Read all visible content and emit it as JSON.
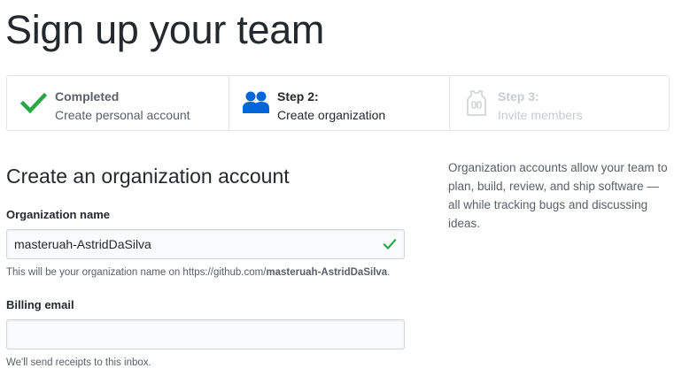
{
  "page": {
    "title": "Sign up your team"
  },
  "steps": [
    {
      "title": "Completed",
      "subtitle": "Create personal account",
      "icon": "check-icon",
      "state": "complete"
    },
    {
      "title": "Step 2:",
      "subtitle": "Create organization",
      "icon": "people-icon",
      "state": "current"
    },
    {
      "title": "Step 3:",
      "subtitle": "Invite members",
      "icon": "jersey-icon",
      "state": "upcoming"
    }
  ],
  "form": {
    "heading": "Create an organization account",
    "org_name_label": "Organization name",
    "org_name_value": "masteruah-AstridDaSilva",
    "org_name_note_prefix": "This will be your organization name on https://github.com/",
    "org_name_note_name": "masteruah-AstridDaSilva",
    "org_name_note_suffix": ".",
    "billing_label": "Billing email",
    "billing_value": "",
    "billing_note": "We'll send receipts to this inbox."
  },
  "aside": {
    "text": "Organization accounts allow your team to plan, build, review, and ship software — all while tracking bugs and discussing ideas."
  },
  "colors": {
    "success": "#28a745",
    "accent": "#0366d6",
    "muted": "#586069",
    "disabled": "#c6cbd1"
  }
}
